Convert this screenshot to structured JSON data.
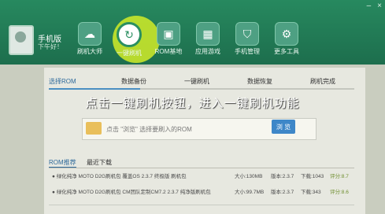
{
  "window": {
    "controls": [
      "–",
      "×"
    ]
  },
  "user": {
    "name": "手机版",
    "status": "下午好！"
  },
  "nav": {
    "items": [
      {
        "label": "刷机大师"
      },
      {
        "label": "一键刷机"
      },
      {
        "label": "ROM基地"
      },
      {
        "label": "应用游戏"
      },
      {
        "label": "手机管理"
      },
      {
        "label": "更多工具"
      }
    ]
  },
  "steps": [
    "选择ROM",
    "数据备份",
    "一键刷机",
    "数据恢复",
    "刷机完成"
  ],
  "progress": {
    "fraction": 0.3
  },
  "overlay": {
    "text": "点击一键刷机按钮，进入一键刷机功能"
  },
  "file": {
    "placeholder_text": "点击 \"浏览\" 选择要刷入的ROM"
  },
  "browse": {
    "label": "浏 览"
  },
  "tabs": [
    "ROM推荐",
    "最近下载"
  ],
  "rows": [
    {
      "title": "● 绿化纯净 MOTO D2G刷机包 覆盖OS 2.3.7 终极版 刷机包",
      "size": "大小:130MB",
      "version": "版本:2.3.7",
      "downloads": "下载:1043",
      "score": "评分:8.7"
    },
    {
      "title": "● 绿化纯净 MOTO D2G刷机包 CM团队定制CM7.2 2.3.7 纯净版刷机包",
      "size": "大小:99.7MB",
      "version": "版本:2.3.7",
      "downloads": "下载:343",
      "score": "评分:8.6"
    }
  ]
}
